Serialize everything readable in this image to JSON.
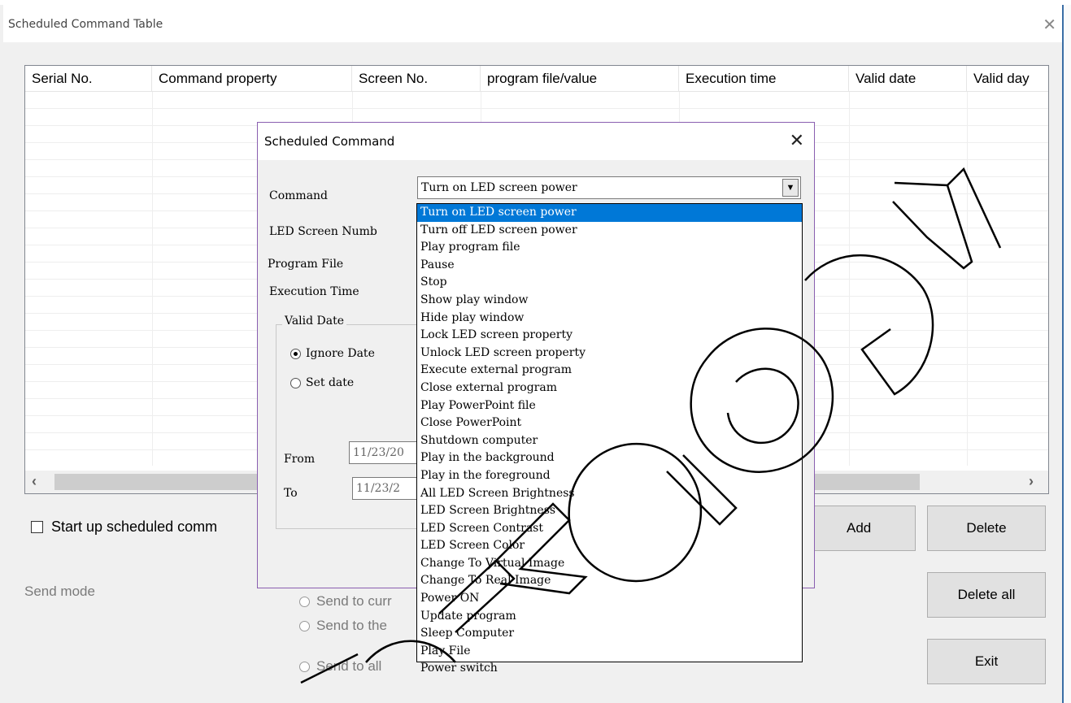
{
  "window": {
    "title": "Scheduled Command Table",
    "close_glyph": "✕"
  },
  "table": {
    "columns": [
      "Serial No.",
      "Command property",
      "Screen No.",
      "program file/value",
      "Execution time",
      "Valid date",
      "Valid day"
    ]
  },
  "startup_checkbox": {
    "label": "Start up scheduled comm",
    "checked": false
  },
  "send_mode": {
    "label": "Send mode",
    "options": [
      "Send to curr",
      "Send to the",
      "Send to all"
    ]
  },
  "buttons": {
    "add": "Add",
    "delete": "Delete",
    "delete_all": "Delete all",
    "exit": "Exit"
  },
  "dialog": {
    "title": "Scheduled Command",
    "close_glyph": "✕",
    "labels": {
      "command": "Command",
      "screen_num": "LED Screen Numb",
      "program_file": "Program File",
      "execution_time": "Execution Time",
      "from": "From",
      "to": "To"
    },
    "command_value": "Turn on LED screen power",
    "valid_date": {
      "group_label": "Valid Date",
      "ignore_label": "Ignore Date",
      "set_label": "Set date",
      "selected": "ignore"
    },
    "from_value": "11/23/20",
    "to_value": "11/23/2"
  },
  "dropdown": {
    "selected_index": 0,
    "items": [
      "Turn on LED screen power",
      "Turn off LED screen power",
      "Play program file",
      "Pause",
      "Stop",
      "Show play window",
      "Hide play window",
      "Lock LED screen property",
      "Unlock LED screen property",
      "Execute external program",
      "Close external program",
      "Play PowerPoint file",
      "Close PowerPoint",
      "Shutdown computer",
      "Play in the background",
      "Play in the foreground",
      "All LED Screen Brightness",
      "LED Screen Brightness",
      "LED Screen Contrast",
      "LED Screen Color",
      "Change To Virtual Image",
      "Change To Real Image",
      "Power ON",
      "Update program",
      "Sleep Computer",
      "Play File",
      "Power switch"
    ]
  },
  "watermark": {
    "text": "TECHNOLOGY"
  }
}
